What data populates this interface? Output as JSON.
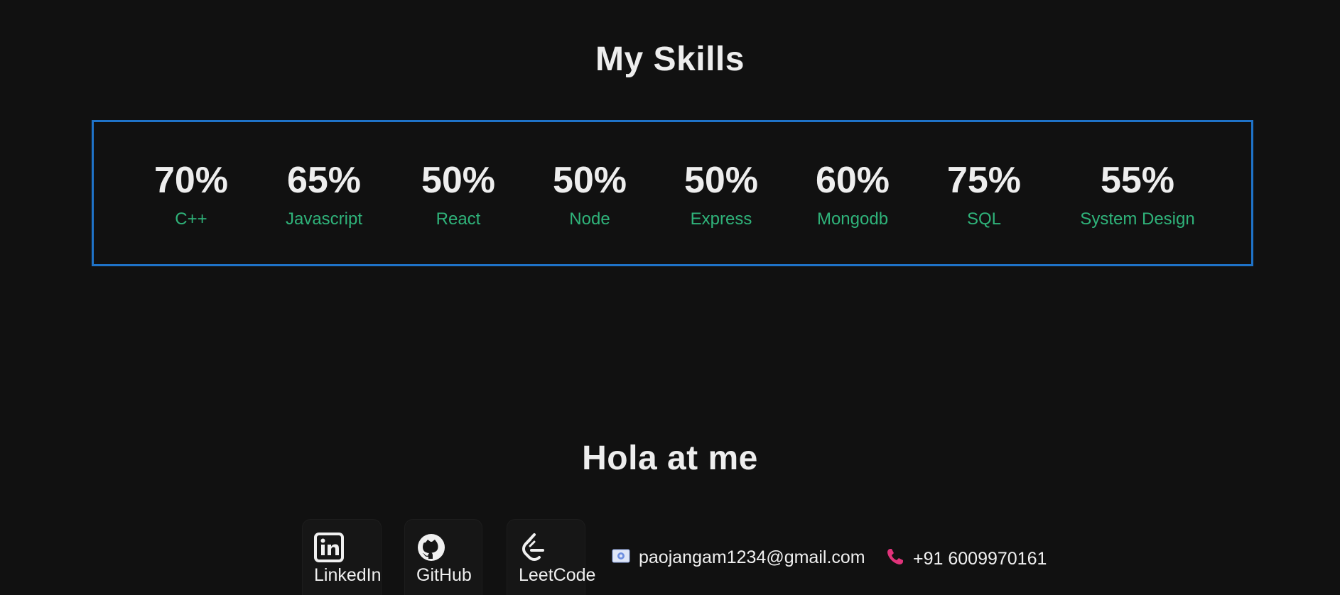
{
  "skills": {
    "title": "My Skills",
    "items": [
      {
        "value": "70%",
        "label": "C++"
      },
      {
        "value": "65%",
        "label": "Javascript"
      },
      {
        "value": "50%",
        "label": "React"
      },
      {
        "value": "50%",
        "label": "Node"
      },
      {
        "value": "50%",
        "label": "Express"
      },
      {
        "value": "60%",
        "label": "Mongodb"
      },
      {
        "value": "75%",
        "label": "SQL"
      },
      {
        "value": "55%",
        "label": "System Design"
      }
    ],
    "colors": {
      "border": "#1f73c8",
      "label": "#2fb37a"
    }
  },
  "contact": {
    "title": "Hola at me",
    "links": [
      {
        "label": "LinkedIn",
        "icon": "linkedin-icon"
      },
      {
        "label": "GitHub",
        "icon": "github-icon"
      },
      {
        "label": "LeetCode",
        "icon": "leetcode-icon"
      }
    ],
    "email": {
      "text": "paojangam1234@gmail.com",
      "icon": "email-icon"
    },
    "phone": {
      "text": "+91 6009970161",
      "icon": "phone-icon"
    },
    "colors": {
      "phone_icon": "#e0337a",
      "email_icon": "#6f8fe0"
    }
  }
}
